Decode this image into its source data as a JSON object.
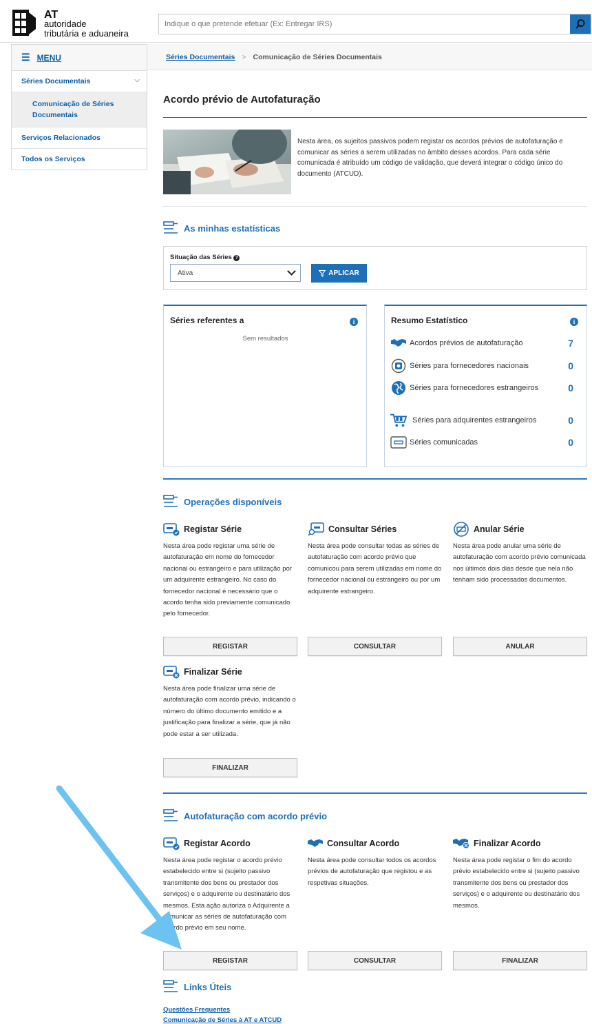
{
  "header": {
    "logo_at": "AT",
    "logo_line1": "autoridade",
    "logo_line2": "tributária e aduaneira",
    "search_placeholder": "Indique o que pretende efetuar (Ex: Entregar IRS)"
  },
  "sidebar": {
    "menu_label": "MENU",
    "items": [
      {
        "label": "Séries Documentais"
      },
      {
        "label": "Comunicação de Séries Documentais"
      },
      {
        "label": "Serviços Relacionados"
      },
      {
        "label": "Todos os Serviços"
      }
    ]
  },
  "breadcrumb": {
    "parent": "Séries Documentais",
    "separator": ">",
    "current": "Comunicação de Séries Documentais"
  },
  "page": {
    "title": "Acordo prévio de Autofaturação",
    "intro": "Nesta área, os sujeitos passivos podem registar os acordos prévios de autofaturação e comunicar as séries a serem utilizadas no âmbito desses acordos. Para cada série comunicada é atribuído um código de validação, que deverá integrar o código único do documento (ATCUD)."
  },
  "stats": {
    "heading": "As minhas estatísticas",
    "filter_label": "Situação das Séries",
    "filter_value": "Ativa",
    "apply_label": "APLICAR",
    "left_card": {
      "title": "Séries referentes a",
      "empty": "Sem resultados"
    },
    "right_card": {
      "title": "Resumo Estatístico",
      "rows": [
        {
          "label": "Acordos prévios de autofaturação",
          "value": "7",
          "icon": "handshake-icon"
        },
        {
          "label": "Séries para fornecedores nacionais",
          "value": "0",
          "icon": "national-supplier-icon"
        },
        {
          "label": "Séries para fornecedores estrangeiros",
          "value": "0",
          "icon": "globe-icon"
        },
        {
          "label": "Séries para adquirentes estrangeiros",
          "value": "0",
          "icon": "cart-icon"
        },
        {
          "label": "Séries comunicadas",
          "value": "0",
          "icon": "series-card-icon"
        }
      ]
    }
  },
  "operations": {
    "heading": "Operações disponíveis",
    "items": [
      {
        "title": "Registar Série",
        "desc": "Nesta área pode registar uma série de autofaturação em nome do fornecedor nacional ou estrangeiro e para utilização por um adquirente estrangeiro. No caso do fornecedor nacional é necessário que o acordo tenha sido previamente comunicado pelo fornecedor.",
        "button": "REGISTAR"
      },
      {
        "title": "Consultar Séries",
        "desc": "Nesta área pode consultar todas as séries de autofaturação com acordo prévio que comunicou para serem utilizadas em nome do fornecedor nacional ou estrangeiro ou por um adquirente estrangeiro.",
        "button": "CONSULTAR"
      },
      {
        "title": "Anular Série",
        "desc": "Nesta área pode anular uma série de autofaturação com acordo prévio comunicada nos últimos dois dias desde que nela não tenham sido processados documentos.",
        "button": "ANULAR"
      },
      {
        "title": "Finalizar Série",
        "desc": "Nesta área pode finalizar uma série de autofaturação com acordo prévio, indicando o número do último documento emitido e a justificação para finalizar a série, que já não pode estar a ser utilizada.",
        "button": "FINALIZAR"
      }
    ]
  },
  "agreements": {
    "heading": "Autofaturação com acordo prévio",
    "items": [
      {
        "title": "Registar Acordo",
        "desc": "Nesta área pode registar o acordo prévio estabelecido entre si (sujeito passivo transmitente dos bens ou prestador dos serviços) e o adquirente ou destinatário dos mesmos. Esta ação autoriza o Adquirente a comunicar as séries de autofaturação com acordo prévio em seu nome.",
        "button": "REGISTAR"
      },
      {
        "title": "Consultar Acordo",
        "desc": "Nesta área pode consultar todos os acordos prévios de autofaturação que registou e as respetivas situações.",
        "button": "CONSULTAR"
      },
      {
        "title": "Finalizar Acordo",
        "desc": "Nesta área pode registar o fim do acordo prévio estabelecido entre si (sujeito passivo transmitente dos bens ou prestador dos serviços) e o adquirente ou destinatário dos mesmos.",
        "button": "FINALIZAR"
      }
    ]
  },
  "links": {
    "heading": "Links Úteis",
    "items": [
      {
        "label": "Questões Frequentes"
      },
      {
        "label": "Comunicação de Séries à AT e ATCUD"
      }
    ]
  },
  "colors": {
    "accent": "#1d6fb8",
    "annotation_arrow": "#6cc3f2"
  }
}
